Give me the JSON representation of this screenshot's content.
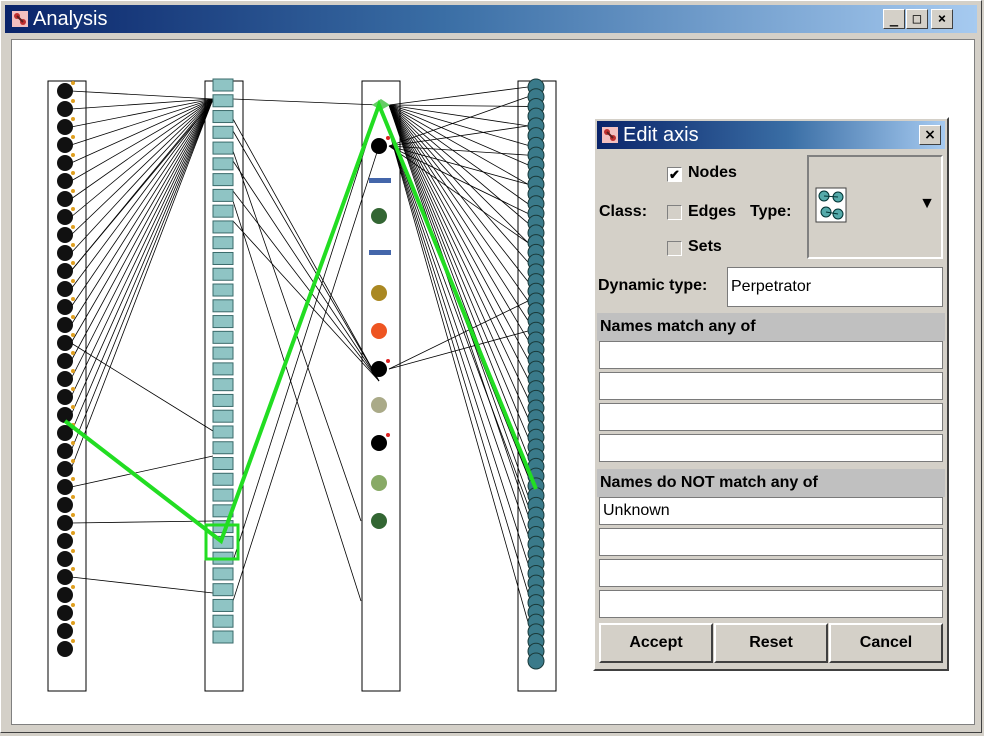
{
  "window": {
    "title": "Analysis",
    "controls": [
      "_",
      "□",
      "×"
    ]
  },
  "colors": {
    "highlight": "#22dd22",
    "titlebar_start": "#0a246a",
    "titlebar_end": "#a6caf0"
  },
  "axes": [
    {
      "name": "axis-1",
      "icon": "bomb-icon",
      "node_count": 32
    },
    {
      "name": "axis-2",
      "icon": "chain-icon",
      "node_count": 36
    },
    {
      "name": "axis-3",
      "icons": [
        "kite-icon",
        "bomb-icon",
        "rifle-icon",
        "palm-icon",
        "rifle-icon",
        "torch-icon",
        "fire-icon",
        "bomb-icon",
        "fist-icon",
        "bomb-icon",
        "knife-icon",
        "grenade-icon"
      ]
    },
    {
      "name": "axis-4",
      "icon": "globe-icon",
      "node_count": 60
    }
  ],
  "edit_axis": {
    "title": "Edit axis",
    "close": "×",
    "class_label": "Class:",
    "nodes_label": "Nodes",
    "nodes_checked": true,
    "nodes_mark": "✔",
    "edges_label": "Edges",
    "edges_checked": false,
    "sets_label": "Sets",
    "sets_checked": false,
    "type_label": "Type:",
    "type_icon": "nodes-type-icon",
    "dropdown_arrow": "▼",
    "dynamic_type_label": "Dynamic type:",
    "dynamic_type_value": "Perpetrator",
    "names_match_label": "Names match any of",
    "names_match_values": [
      "",
      "",
      "",
      ""
    ],
    "names_not_match_label": "Names do NOT match any of",
    "names_not_match_values": [
      "Unknown",
      "",
      "",
      ""
    ],
    "buttons": {
      "accept": "Accept",
      "reset": "Reset",
      "cancel": "Cancel"
    }
  }
}
